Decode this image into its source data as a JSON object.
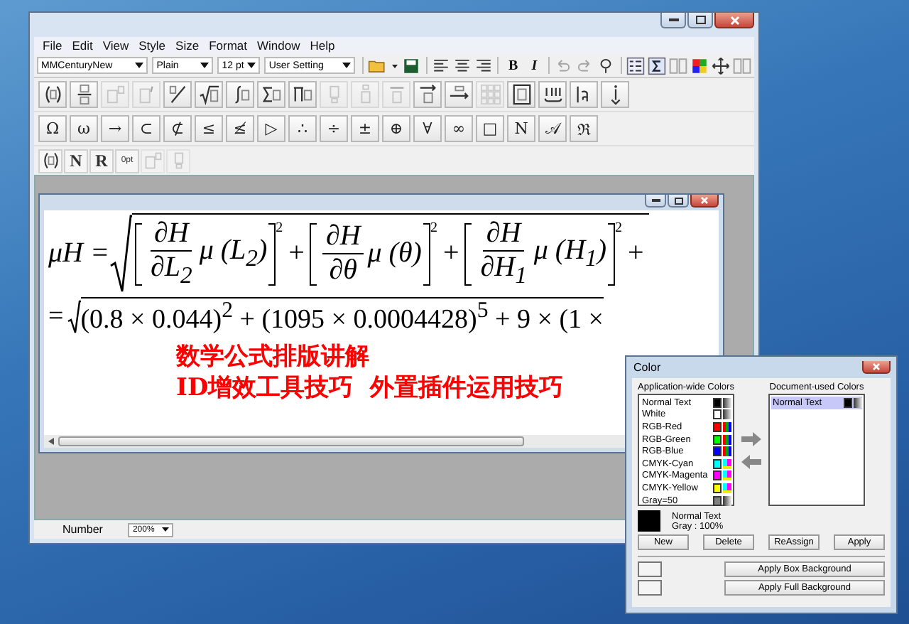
{
  "main_window": {
    "menu": [
      "File",
      "Edit",
      "View",
      "Style",
      "Size",
      "Format",
      "Window",
      "Help"
    ],
    "format_toolbar": {
      "dropdowns": [
        "MMCenturyNew",
        "Plain",
        "12 pt",
        "User Setting"
      ],
      "groups": [
        [
          {
            "kind": "icon",
            "disabled": false
          },
          {
            "kind": "icon",
            "disabled": false
          },
          {
            "kind": "icon",
            "disabled": false
          }
        ],
        [
          {
            "kind": "icon",
            "disabled": false
          },
          {
            "kind": "icon",
            "disabled": false
          },
          {
            "kind": "icon",
            "disabled": false
          }
        ],
        [
          {
            "kind": "text",
            "label": "B",
            "disabled": false
          },
          {
            "kind": "text",
            "label": "I",
            "disabled": false
          }
        ],
        [
          {
            "kind": "icon",
            "disabled": true
          },
          {
            "kind": "icon",
            "disabled": true
          },
          {
            "kind": "icon",
            "disabled": false
          }
        ],
        [
          {
            "kind": "icon",
            "disabled": false
          },
          {
            "kind": "icon",
            "disabled": false
          },
          {
            "kind": "icon",
            "disabled": true
          },
          {
            "kind": "icon",
            "disabled": false
          },
          {
            "kind": "icon",
            "disabled": false
          },
          {
            "kind": "icon",
            "disabled": true
          }
        ]
      ]
    },
    "template_palette": [
      {
        "disabled": false
      },
      {
        "disabled": false
      },
      {
        "disabled": true
      },
      {
        "disabled": true
      },
      {
        "disabled": false
      },
      {
        "disabled": false
      },
      {
        "disabled": false
      },
      {
        "disabled": false
      },
      {
        "disabled": false
      },
      {
        "disabled": true
      },
      {
        "disabled": true
      },
      {
        "disabled": true
      },
      {
        "disabled": false
      },
      {
        "disabled": false
      },
      {
        "disabled": true
      },
      {
        "disabled": false
      },
      {
        "disabled": false
      },
      {
        "disabled": false
      },
      {
        "disabled": false
      }
    ],
    "symbol_palette": [
      "Ω",
      "ω",
      "→",
      "⊂",
      "⊄",
      "≤",
      "≰",
      "▷",
      "∴",
      "÷",
      "±",
      "⊕",
      "∀",
      "∞",
      "□",
      "N",
      "𝒜",
      "ℜ"
    ],
    "tab_bar": [
      {
        "kind": "icon",
        "disabled": false
      },
      {
        "kind": "text",
        "label": "N",
        "disabled": false
      },
      {
        "kind": "text",
        "label": "R",
        "disabled": false
      },
      {
        "kind": "text",
        "label": "0pt",
        "disabled": false
      },
      {
        "kind": "icon",
        "disabled": true
      },
      {
        "kind": "icon",
        "disabled": true
      }
    ],
    "equation_window": {
      "line_1": {
        "lhs": "μH =",
        "terms": [
          {
            "numerator": "∂H",
            "denominator": "∂L$_{2}$",
            "factor": "μ (L$_{2}$)",
            "power": "2",
            "operator": "+"
          },
          {
            "numerator": "∂H",
            "denominator": "∂θ",
            "factor": "μ (θ)",
            "power": "2",
            "operator": "+"
          },
          {
            "numerator": "∂H",
            "denominator": "∂H$_{1}$",
            "factor": "μ (H$_{1}$)",
            "power": "2",
            "operator": "+"
          }
        ]
      },
      "line_2": {
        "lead": "=",
        "radicand": "(0.8 × 0.044)$^{2}$ + (1095 × 0.0004428)$^{5}$ + 9 × (1 ×"
      },
      "caption": [
        "数学公式排版讲解",
        "ID增效工具技巧  外置插件运用技巧"
      ]
    },
    "status_bar": {
      "label": "Number",
      "zoom": "200%"
    }
  },
  "color_dialog": {
    "title": "Color",
    "app_heading": "Application-wide Colors",
    "doc_heading": "Document-used Colors",
    "app_colors": [
      {
        "name": "Normal Text",
        "color": "#000000",
        "kind": "gray",
        "selected": false
      },
      {
        "name": "White",
        "color": "#ffffff",
        "kind": "gray",
        "selected": false
      },
      {
        "name": "RGB-Red",
        "color": "#ff0000",
        "kind": "rgb",
        "selected": false
      },
      {
        "name": "RGB-Green",
        "color": "#00ff00",
        "kind": "rgb",
        "selected": false
      },
      {
        "name": "RGB-Blue",
        "color": "#0000ff",
        "kind": "rgb",
        "selected": false
      },
      {
        "name": "CMYK-Cyan",
        "color": "#00ffff",
        "kind": "cmyk",
        "selected": false
      },
      {
        "name": "CMYK-Magenta",
        "color": "#ff00ff",
        "kind": "cmyk",
        "selected": false
      },
      {
        "name": "CMYK-Yellow",
        "color": "#ffff00",
        "kind": "cmyk",
        "selected": false
      },
      {
        "name": "Gray=50",
        "color": "#808080",
        "kind": "gray",
        "selected": false
      }
    ],
    "doc_colors": [
      {
        "name": "Normal Text",
        "color": "#000000",
        "kind": "gray",
        "selected": true
      }
    ],
    "preview": {
      "color": "#000000",
      "name": "Normal Text",
      "detail": "Gray :  100%"
    },
    "buttons": [
      "New",
      "Delete",
      "ReAssign",
      "Apply"
    ],
    "background_buttons": [
      "Apply Box Background",
      "Apply Full Background"
    ]
  }
}
